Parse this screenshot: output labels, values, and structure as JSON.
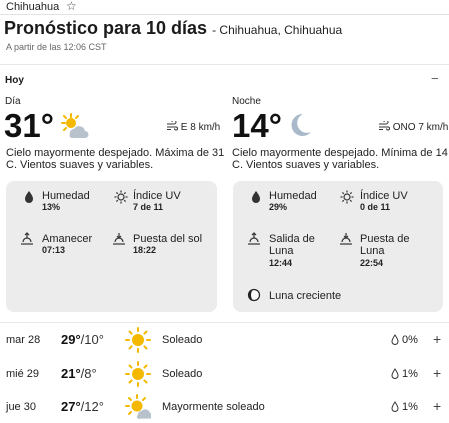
{
  "tab": {
    "city": "Chihuahua"
  },
  "header": {
    "title": "Pronóstico para 10 días",
    "location": "- Chihuahua, Chihuahua",
    "as_of": "A partir de las 12:06 CST"
  },
  "today": {
    "label": "Hoy",
    "day": {
      "label": "Día",
      "temp": "31°",
      "wind": "E 8 km/h",
      "description": "Cielo mayormente despejado. Máxima de 31 C. Vientos suaves y variables.",
      "humidity_label": "Humedad",
      "humidity_value": "13%",
      "uv_label": "Índice UV",
      "uv_value": "7 de 11",
      "sunrise_label": "Amanecer",
      "sunrise_value": "07:13",
      "sunset_label": "Puesta del sol",
      "sunset_value": "18:22"
    },
    "night": {
      "label": "Noche",
      "temp": "14°",
      "wind": "ONO 7 km/h",
      "description": "Cielo mayormente despejado. Mínima de 14 C. Vientos suaves y variables.",
      "humidity_label": "Humedad",
      "humidity_value": "29%",
      "uv_label": "Índice UV",
      "uv_value": "0 de 11",
      "moonrise_label_1": "Salida de",
      "moonrise_label_2": "Luna",
      "moonrise_value": "12:44",
      "moonset_label_1": "Puesta de",
      "moonset_label_2": "Luna",
      "moonset_value": "22:54",
      "moon_phase": "Luna creciente"
    }
  },
  "forecast": [
    {
      "day": "mar 28",
      "high": "29°",
      "low": "/10°",
      "condition": "Soleado",
      "icon": "sun-icon",
      "precip": "0%"
    },
    {
      "day": "mié 29",
      "high": "21°",
      "low": "/8°",
      "condition": "Soleado",
      "icon": "sun-icon",
      "precip": "1%"
    },
    {
      "day": "jue 30",
      "high": "27°",
      "low": "/12°",
      "condition": "Mayormente soleado",
      "icon": "mostly-sunny-icon",
      "precip": "1%"
    }
  ],
  "colors": {
    "sun": "#f5b800",
    "cloud": "#9aa7b4",
    "moon": "#a8b9c9",
    "card": "#ececec"
  }
}
